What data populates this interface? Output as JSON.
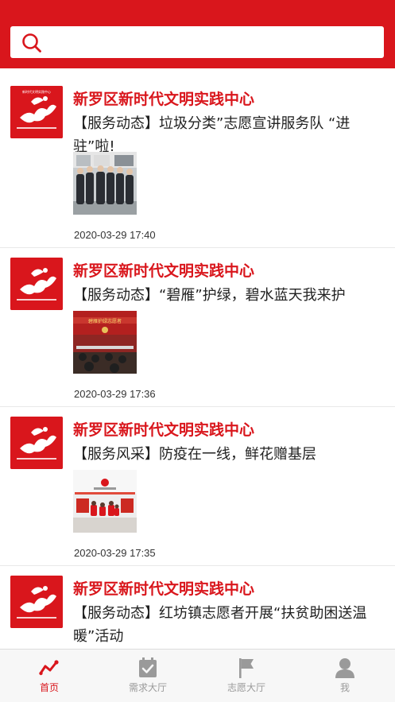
{
  "search": {
    "placeholder": ""
  },
  "feed": {
    "items": [
      {
        "org": "新罗区新时代文明实践中心",
        "title": "【服务动态】垃圾分类”志愿宣讲服务队 “进驻”啦!",
        "time": "2020-03-29 17:40"
      },
      {
        "org": "新罗区新时代文明实践中心",
        "title": "【服务动态】“碧雁”护绿，碧水蓝天我来护",
        "time": "2020-03-29 17:36"
      },
      {
        "org": "新罗区新时代文明实践中心",
        "title": "【服务风采】防疫在一线，鲜花赠基层",
        "time": "2020-03-29 17:35"
      },
      {
        "org": "新罗区新时代文明实践中心",
        "title": "【服务动态】红坊镇志愿者开展“扶贫助困送温暖”活动",
        "time": ""
      }
    ]
  },
  "tabbar": {
    "tabs": [
      {
        "label": "首页",
        "icon": "trend-icon",
        "active": true
      },
      {
        "label": "需求大厅",
        "icon": "checklist-icon",
        "active": false
      },
      {
        "label": "志愿大厅",
        "icon": "flag-icon",
        "active": false
      },
      {
        "label": "我",
        "icon": "user-icon",
        "active": false
      }
    ]
  },
  "colors": {
    "brand": "#d9161c",
    "inactive": "#9a9a9a"
  }
}
